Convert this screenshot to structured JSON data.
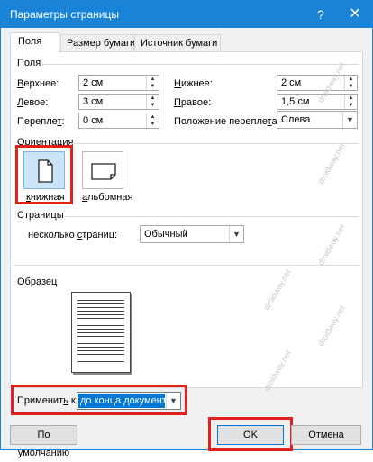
{
  "window": {
    "title": "Параметры страницы",
    "help": "?",
    "close": "✕"
  },
  "tabs": [
    {
      "label": "Поля",
      "active": true
    },
    {
      "label": "Размер бумаги",
      "active": false
    },
    {
      "label": "Источник бумаги",
      "active": false
    }
  ],
  "margins": {
    "section_title": "Поля",
    "top": {
      "label_underlined": "В",
      "label_rest": "ерхнее:",
      "value": "2 см"
    },
    "bottom": {
      "label_underlined": "Н",
      "label_rest": "ижнее:",
      "value": "2 см"
    },
    "left": {
      "label_underlined": "Л",
      "label_rest": "евое:",
      "value": "3 см"
    },
    "right": {
      "label_underlined": "П",
      "label_rest": "равое:",
      "value": "1,5 см"
    },
    "gutter": {
      "label_pre": "Перепле",
      "label_underlined": "т",
      "label_rest": ":",
      "value": "0 см"
    },
    "gutter_pos": {
      "label_pre": "Положение перепле",
      "label_underlined": "т",
      "label_rest": "а:",
      "value": "Слева"
    }
  },
  "orientation": {
    "section_title": "Ориентация",
    "portrait": {
      "label_underlined": "к",
      "label_rest": "нижная",
      "selected": true
    },
    "landscape": {
      "label_underlined": "а",
      "label_rest": "льбомная",
      "selected": false
    }
  },
  "pages": {
    "section_title": "Страницы",
    "multiple": {
      "label_pre": "несколько ",
      "label_underlined": "с",
      "label_rest": "траниц:",
      "value": "Обычный"
    }
  },
  "preview": {
    "section_title": "Образец"
  },
  "apply_to": {
    "label_pre": "Применит",
    "label_underlined": "ь",
    "label_rest": " к:",
    "value": "до конца документа"
  },
  "buttons": {
    "default": "По умолчанию",
    "ok": "OK",
    "cancel": "Отмена"
  },
  "watermark": "droidway.net",
  "colors": {
    "titlebar": "#1883d7",
    "highlight": "#e2201c",
    "selection": "#0078d7"
  }
}
